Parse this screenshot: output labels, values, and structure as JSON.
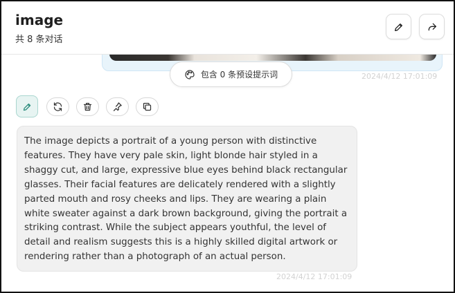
{
  "header": {
    "title": "image",
    "subtitle": "共 8 条对话",
    "edit_icon": "pencil-icon",
    "share_icon": "share-icon"
  },
  "user_message": {
    "image_alt": "portrait image thumbnail",
    "timestamp": "2024/4/12 17:01:09"
  },
  "prompt_pill": {
    "icon": "palette-icon",
    "label": "包含 0 条预设提示词"
  },
  "actions": [
    {
      "icon": "pencil-icon"
    },
    {
      "icon": "refresh-icon"
    },
    {
      "icon": "trash-icon"
    },
    {
      "icon": "pin-icon"
    },
    {
      "icon": "copy-icon"
    }
  ],
  "assistant_message": {
    "text": "The image depicts a portrait of a young person with distinctive features. They have very pale skin, light blonde hair styled in a shaggy cut, and large, expressive blue eyes behind black rectangular glasses. Their facial features are delicately rendered with a slightly parted mouth and rosy cheeks and lips. They are wearing a plain white sweater against a dark brown background, giving the portrait a striking contrast. While the subject appears youthful, the level of detail and realism suggests this is a highly skilled digital artwork or rendering rather than a photograph of an actual person.",
    "timestamp": "2024/4/12 17:01:09"
  },
  "colors": {
    "accent_teal": "#2a8c7c",
    "user_bubble": "#e8f4fb",
    "assistant_bubble": "#f1f1f1",
    "timestamp": "#d2d2d2"
  }
}
